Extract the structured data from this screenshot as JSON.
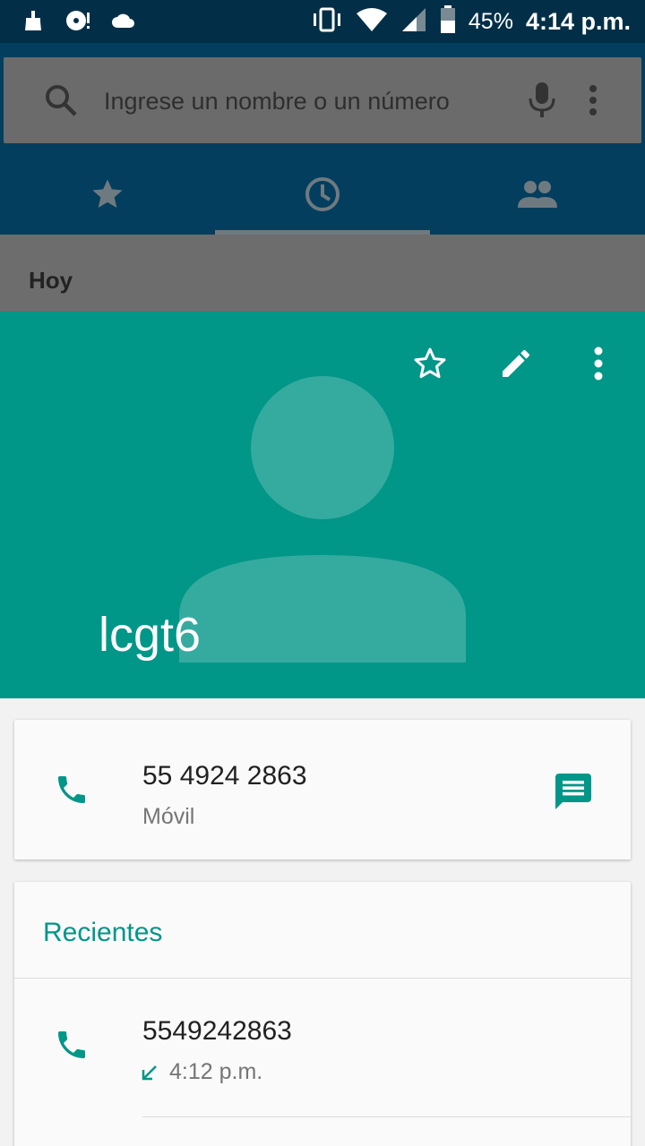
{
  "status_bar": {
    "battery_percent": "45%",
    "time": "4:14 p.m.",
    "icons": [
      "cleaner-icon",
      "media-icon",
      "cloud-icon",
      "vibrate-icon",
      "wifi-icon",
      "signal-icon",
      "battery-icon"
    ]
  },
  "search": {
    "placeholder": "Ingrese un nombre o un número"
  },
  "tabs": [
    {
      "icon": "star-icon"
    },
    {
      "icon": "clock-icon",
      "selected": true
    },
    {
      "icon": "people-icon"
    }
  ],
  "list": {
    "section_header": "Hoy"
  },
  "contact": {
    "name": "lcgt6",
    "header_color": "#009688"
  },
  "phone_entry": {
    "number": "55 4924 2863",
    "type": "Móvil"
  },
  "recents": {
    "title": "Recientes",
    "items": [
      {
        "number": "5549242863",
        "time": "4:12 p.m.",
        "direction": "incoming"
      }
    ]
  }
}
